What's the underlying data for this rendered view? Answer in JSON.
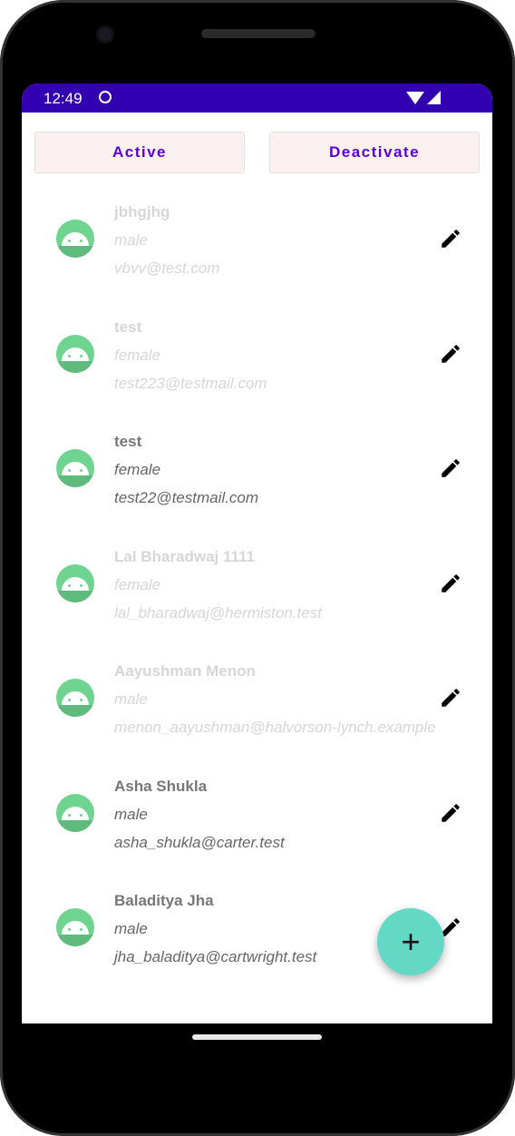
{
  "status_bar": {
    "time": "12:49",
    "icons": [
      "cat-notification-icon",
      "wifi-icon",
      "signal-icon"
    ],
    "color": "#3300b1"
  },
  "buttons": {
    "active_label": "Active",
    "deactivate_label": "Deactivate",
    "accent": "#5b00d6"
  },
  "users": [
    {
      "name": "jbhgjhg",
      "gender": "male",
      "email": "vbvv@test.com",
      "active": false
    },
    {
      "name": "test",
      "gender": "female",
      "email": "test223@testmail.com",
      "active": false
    },
    {
      "name": "test",
      "gender": "female",
      "email": "test22@testmail.com",
      "active": true
    },
    {
      "name": "Lal Bharadwaj 1111",
      "gender": "female",
      "email": "lal_bharadwaj@hermiston.test",
      "active": false
    },
    {
      "name": "Aayushman Menon",
      "gender": "male",
      "email": "menon_aayushman@halvorson-lynch.example",
      "active": false
    },
    {
      "name": "Asha Shukla",
      "gender": "male",
      "email": "asha_shukla@carter.test",
      "active": true
    },
    {
      "name": "Baladitya Jha",
      "gender": "male",
      "email": "jha_baladitya@cartwright.test",
      "active": true
    }
  ],
  "fab": {
    "icon": "plus-icon",
    "label": "+",
    "color": "#62d8c5"
  }
}
